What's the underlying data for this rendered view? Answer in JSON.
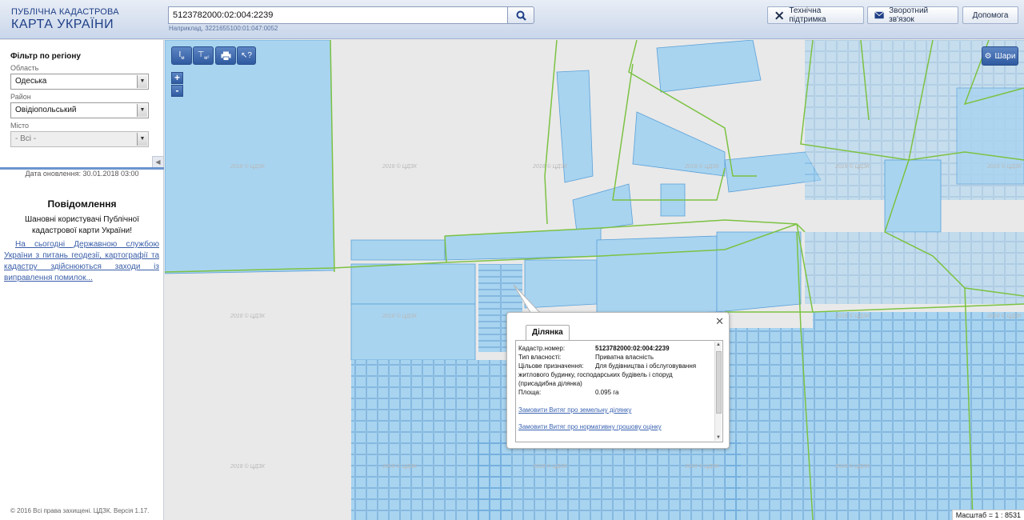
{
  "header": {
    "logo_line1": "ПУБЛІЧНА КАДАСТРОВА",
    "logo_line2": "КАРТА УКРАЇНИ",
    "search_value": "5123782000:02:004:2239",
    "example_text": "Наприклад, 3221655100:01:047:0052",
    "search_icon": "magnifier-icon",
    "buttons": {
      "support": "Технічна підтримка",
      "feedback": "Зворотний зв'язок",
      "help": "Допомога"
    }
  },
  "sidebar": {
    "filter_title": "Фільтр по регіону",
    "oblast_label": "Область",
    "oblast_value": "Одеська",
    "rayon_label": "Район",
    "rayon_value": "Овідіопольський",
    "misto_label": "Місто",
    "misto_value": "- Всі -",
    "update_date": "Дата оновлення: 30.01.2018 03:00",
    "news_title": "Повідомлення",
    "news_greeting": "Шановні користувачі Публічної кадастрової карти України!",
    "news_text": "На сьогодні Державною службою України з питань геодезії, картографії та кадастру здійснюються заходи із виправлення помилок...",
    "copyright": "© 2016 Всі права захищені. ЦДЗК. Версія 1.17."
  },
  "map": {
    "layers_label": "Шари",
    "zoom_in": "+",
    "zoom_out": "-",
    "scale_text": "Масштаб = 1 : 8531",
    "watermark": "2018 © ЦДЗК",
    "parcel_fill": "#a8d4f0",
    "parcel_stroke": "#5aa0d8",
    "boundary_color": "#7cc242"
  },
  "popup": {
    "tab_label": "Ділянка",
    "cadastral_label": "Кадастр.номер:",
    "cadastral_value": "5123782000:02:004:2239",
    "ownership_label": "Тип власності:",
    "ownership_value": "Приватна власність",
    "purpose_label": "Цільове призначення:",
    "purpose_value_1": "Для будівництва і обслуговування",
    "purpose_value_2": "житлового будинку, господарських будівель і споруд",
    "purpose_value_3": "(присадибна ділянка)",
    "area_label": "Площа:",
    "area_value": "0.095 га",
    "link_extract": "Замовити Витяг про земельну ділянку",
    "link_valuation": "Замовити Витяг про нормативну грошову оцінку"
  }
}
